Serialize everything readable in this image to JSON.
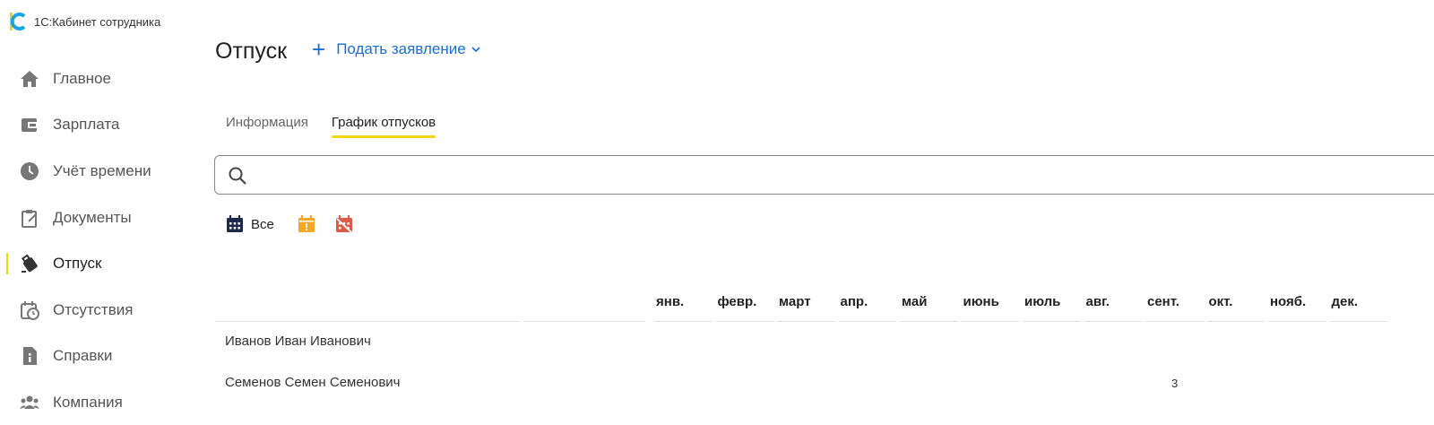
{
  "app": {
    "title": "1С:Кабинет сотрудника"
  },
  "sidebar": {
    "items": [
      {
        "label": "Главное",
        "icon": "home-icon"
      },
      {
        "label": "Зарплата",
        "icon": "wallet-icon"
      },
      {
        "label": "Учёт времени",
        "icon": "clock-icon"
      },
      {
        "label": "Документы",
        "icon": "clipboard-icon"
      },
      {
        "label": "Отпуск",
        "icon": "suitcase-icon",
        "active": true
      },
      {
        "label": "Отсутствия",
        "icon": "calendar-clock-icon"
      },
      {
        "label": "Справки",
        "icon": "document-info-icon"
      },
      {
        "label": "Компания",
        "icon": "people-icon"
      }
    ]
  },
  "header": {
    "title": "Отпуск",
    "apply_label": "Подать заявление"
  },
  "tabs": [
    {
      "label": "Информация"
    },
    {
      "label": "График отпусков",
      "active": true
    }
  ],
  "search": {
    "value": "",
    "placeholder": ""
  },
  "filters": {
    "all_label": "Все"
  },
  "table": {
    "months": [
      "янв.",
      "февр.",
      "март",
      "апр.",
      "май",
      "июнь",
      "июль",
      "авг.",
      "сент.",
      "окт.",
      "нояб.",
      "дек."
    ],
    "rows": [
      {
        "name": "Иванов Иван Иванович",
        "values": [
          "",
          "",
          "",
          "",
          "",
          "",
          "",
          "",
          "",
          "",
          "",
          ""
        ]
      },
      {
        "name": "Семенов Семен Семенович",
        "values": [
          "",
          "",
          "",
          "",
          "",
          "",
          "",
          "",
          "3",
          "",
          "",
          ""
        ]
      }
    ]
  },
  "colors": {
    "accent": "#f5d416",
    "link": "#1a6ed8",
    "filter_planned": "#f5a623",
    "filter_cancelled": "#e05a4a",
    "calendar_all": "#1e2a4a"
  }
}
